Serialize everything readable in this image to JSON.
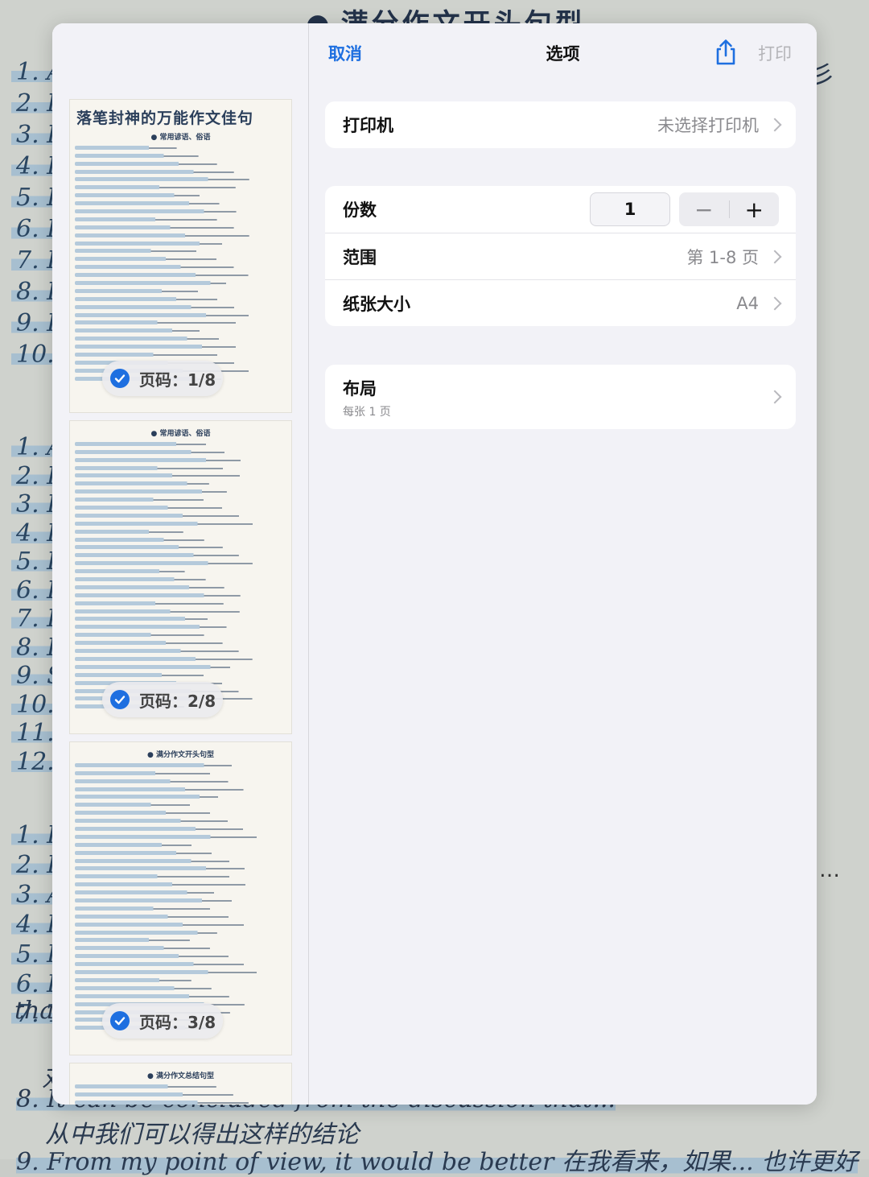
{
  "background": {
    "heading": "满分作文开头句型",
    "line_a": "从中我们可以得出这样的结论",
    "line_b": "8. It can be concluded from the discussion that...",
    "line_c": "9. From my point of view, it would be better 在我看来，如果... 也许更好",
    "side_mark": "…",
    "right_char": "彡",
    "fragments": [
      "thai",
      "对"
    ],
    "numbers_top": [
      "1. A",
      "2. I",
      "3. I",
      "4. I",
      "5. I",
      "6. I",
      "7. I",
      "8. I",
      "9. I",
      "10."
    ],
    "numbers_mid": [
      "1. A",
      "2. B",
      "3. B",
      "4. I",
      "5. I",
      "6. I",
      "7. F",
      "8. H",
      "9. S",
      "10.",
      "11. I",
      "12."
    ],
    "numbers_bot": [
      "1. I",
      "2. I",
      "3. A",
      "4. I",
      "5. I",
      "6. F",
      "7. T"
    ]
  },
  "dialog": {
    "cancel_label": "取消",
    "title": "选项",
    "share_icon": "share-icon",
    "print_label": "打印",
    "accent_color": "#1e6fe0"
  },
  "printer": {
    "label": "打印机",
    "value": "未选择打印机"
  },
  "copies": {
    "label": "份数",
    "value": "1",
    "minus": "−",
    "plus": "+"
  },
  "range": {
    "label": "范围",
    "value": "第 1-8 页"
  },
  "paper": {
    "label": "纸张大小",
    "value": "A4"
  },
  "layout": {
    "label": "布局",
    "sub": "每张 1 页"
  },
  "thumbnails": [
    {
      "title": "落笔封神的万能作文佳句",
      "heading": "● 常用谚语、俗语",
      "page_label": "页码：1/8",
      "selected": true
    },
    {
      "title": "",
      "heading": "● 常用谚语、俗语",
      "page_label": "页码：2/8",
      "selected": true
    },
    {
      "title": "",
      "heading": "● 满分作文开头句型",
      "page_label": "页码：3/8",
      "selected": true
    },
    {
      "title": "",
      "heading": "● 满分作文总结句型",
      "page_label": "",
      "selected": true
    }
  ]
}
